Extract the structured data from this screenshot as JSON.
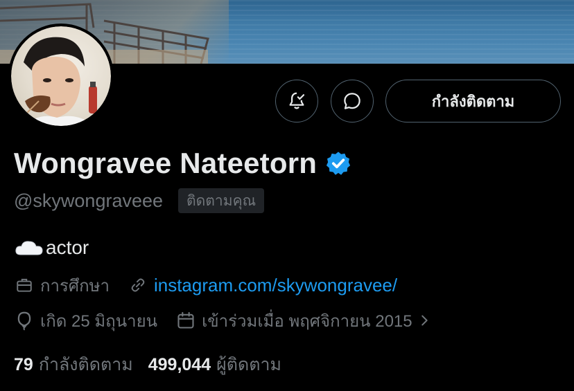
{
  "profile": {
    "display_name": "Wongravee Nateetorn",
    "handle": "@skywongraveee",
    "follows_you_badge": "ติดตามคุณ",
    "bio": "actor",
    "category": "การศึกษา",
    "website": "instagram.com/skywongravee/",
    "birthday": "เกิด 25 มิถุนายน",
    "joined": "เข้าร่วมเมื่อ พฤศจิกายน 2015",
    "following_count": "79",
    "following_label": "กำลังติดตาม",
    "followers_count": "499,044",
    "followers_label": "ผู้ติดตาม"
  },
  "actions": {
    "following_button_label": "กำลังติดตาม"
  },
  "icons": {
    "notify": "bell-check-icon",
    "message": "message-bubble-icon",
    "verified": "verified-badge-icon",
    "bio_emoji": "cloud-icon",
    "category": "briefcase-icon",
    "website": "link-icon",
    "birthday": "balloon-icon",
    "joined": "calendar-icon",
    "joined_more": "chevron-right-icon"
  },
  "colors": {
    "background": "#000000",
    "primary_text": "#e7e9ea",
    "secondary_text": "#71767b",
    "link": "#1d9bf0",
    "verified": "#1d9bf0",
    "button_border": "#536471"
  }
}
